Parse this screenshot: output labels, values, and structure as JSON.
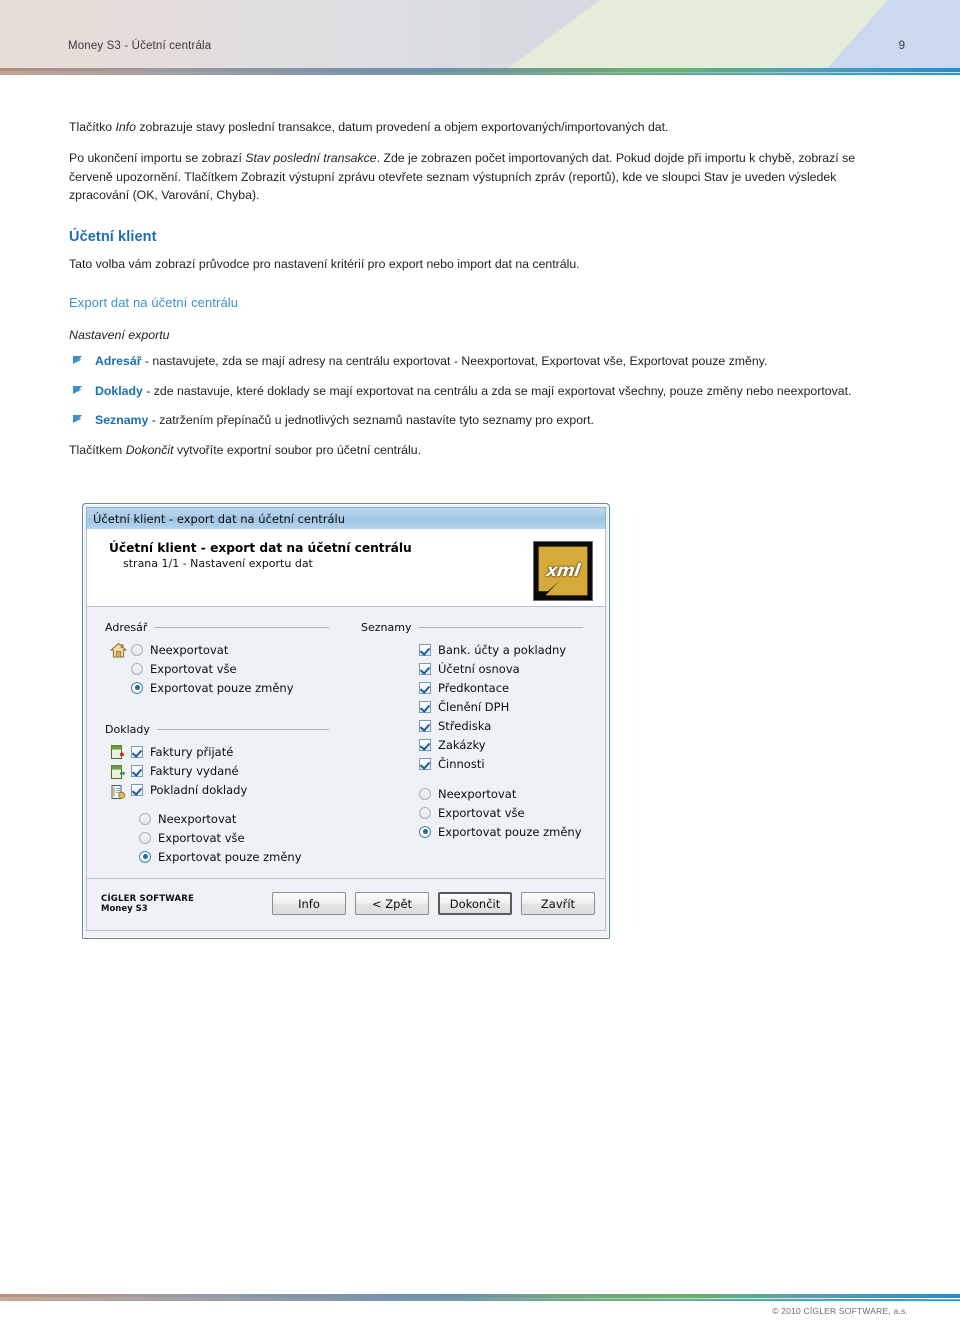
{
  "header": {
    "title": "Money S3 - Účetní centrála",
    "page_number": "9"
  },
  "colors": {
    "heading_blue": "#1a6fb4",
    "subheading_blue": "#3f8fcc",
    "bullet_blue": "#3f8fcc",
    "rule_gradient_start": "#b08b7c",
    "rule_gradient_end": "#1f8fd0"
  },
  "content": {
    "para1_prefix": "Tlačítko ",
    "para1_italic": "Info",
    "para1_suffix": " zobrazuje stavy poslední transakce, datum provedení a objem exportovaných/importovaných dat.",
    "para2_prefix": "Po ukončení importu se zobrazí ",
    "para2_italic": "Stav poslední transakce",
    "para2_suffix": ". Zde je zobrazen počet importovaných dat. Pokud dojde při importu k chybě, zobrazí se červeně upozornění. Tlačítkem Zobrazit výstupní zprávu otevřete seznam výstupních zpráv (reportů), kde ve sloupci Stav je uveden výsledek zpracování (OK, Varování, Chyba).",
    "section_heading": "Účetní klient",
    "section_para": "Tato volba vám zobrazí průvodce pro nastavení kritérií pro export nebo import dat na centrálu.",
    "sub_heading": "Export dat na účetní centrálu",
    "italic_heading": "Nastavení exportu",
    "bullets": [
      {
        "term": "Adresář",
        "text": " - nastavujete, zda se mají adresy na centrálu exportovat - Neexportovat, Exportovat vše, Exportovat pouze změny."
      },
      {
        "term": "Doklady",
        "text": " - zde nastavuje, které doklady se mají exportovat na centrálu a zda se mají exportovat všechny, pouze změny nebo neexportovat."
      },
      {
        "term": "Seznamy",
        "text": " - zatržením přepínačů u jednotlivých seznamů nastavíte tyto seznamy pro export."
      }
    ],
    "closing_prefix": "Tlačítkem ",
    "closing_italic": "Dokončit",
    "closing_suffix": " vytvoříte exportní soubor pro účetní centrálu."
  },
  "dialog": {
    "titlebar": "Účetní klient - export dat na účetní centrálu",
    "banner_title": "Účetní klient - export dat na účetní centrálu",
    "banner_subtitle": "strana 1/1 - Nastavení exportu dat",
    "logo_text": "xml",
    "groups": {
      "adresar": {
        "label": "Adresář",
        "icon": "house-icon",
        "radios": [
          {
            "label": "Neexportovat",
            "checked": false
          },
          {
            "label": "Exportovat vše",
            "checked": false
          },
          {
            "label": "Exportovat pouze změny",
            "checked": true
          }
        ]
      },
      "doklady": {
        "label": "Doklady",
        "checkboxes": [
          {
            "label": "Faktury přijaté",
            "checked": true,
            "icon": "invoice-received-icon"
          },
          {
            "label": "Faktury vydané",
            "checked": true,
            "icon": "invoice-issued-icon"
          },
          {
            "label": "Pokladní doklady",
            "checked": true,
            "icon": "cash-document-icon"
          }
        ],
        "radios": [
          {
            "label": "Neexportovat",
            "checked": false
          },
          {
            "label": "Exportovat vše",
            "checked": false
          },
          {
            "label": "Exportovat pouze změny",
            "checked": true
          }
        ]
      },
      "seznamy": {
        "label": "Seznamy",
        "checkboxes": [
          {
            "label": "Bank. účty a pokladny",
            "checked": true
          },
          {
            "label": "Účetní osnova",
            "checked": true
          },
          {
            "label": "Předkontace",
            "checked": true
          },
          {
            "label": "Členění DPH",
            "checked": true
          },
          {
            "label": "Střediska",
            "checked": true
          },
          {
            "label": "Zakázky",
            "checked": true
          },
          {
            "label": "Činnosti",
            "checked": true
          }
        ],
        "radios": [
          {
            "label": "Neexportovat",
            "checked": false
          },
          {
            "label": "Exportovat vše",
            "checked": false
          },
          {
            "label": "Exportovat pouze změny",
            "checked": true
          }
        ]
      }
    },
    "brand": {
      "line1": "CÍGLER SOFTWARE",
      "line2": "Money S3"
    },
    "buttons": [
      {
        "label": "Info",
        "default": false,
        "accel": ""
      },
      {
        "label": "< Zpět",
        "default": false,
        "accel": "Z"
      },
      {
        "label": "Dokončit",
        "default": true,
        "accel": ""
      },
      {
        "label": "Zavřít",
        "default": false,
        "accel": ""
      }
    ]
  },
  "footer": {
    "copyright": "© 2010 CÍGLER SOFTWARE, a.s."
  }
}
